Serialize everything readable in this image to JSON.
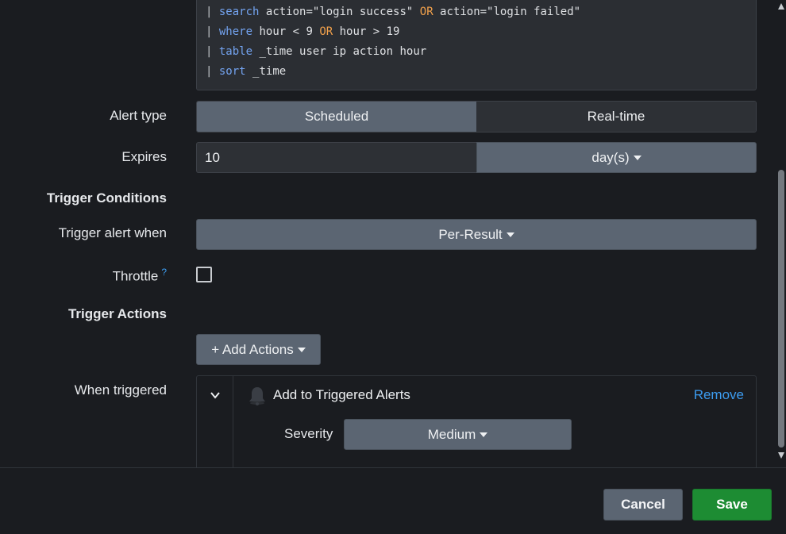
{
  "search": {
    "lines": [
      {
        "pipe": "|",
        "cmd": "search",
        "rest_a": "action=\"login success\" ",
        "op": "OR",
        "rest_b": " action=\"login failed\""
      },
      {
        "pipe": "|",
        "cmd": "where",
        "rest_a": "hour < 9 ",
        "op": "OR",
        "rest_b": " hour > 19"
      },
      {
        "pipe": "|",
        "cmd": "table",
        "rest_a": "_time user ip action hour",
        "op": "",
        "rest_b": ""
      },
      {
        "pipe": "|",
        "cmd": "sort",
        "rest_a": "_time",
        "op": "",
        "rest_b": ""
      }
    ]
  },
  "alert_type": {
    "label": "Alert type",
    "options": [
      "Scheduled",
      "Real-time"
    ],
    "selected": "Scheduled"
  },
  "expires": {
    "label": "Expires",
    "value": "10",
    "unit": "day(s)"
  },
  "trigger_conditions": {
    "heading": "Trigger Conditions",
    "when_label": "Trigger alert when",
    "when_value": "Per-Result",
    "throttle_label": "Throttle",
    "throttle_help": "?",
    "throttle_checked": false
  },
  "trigger_actions": {
    "heading": "Trigger Actions",
    "add_button": "+ Add Actions",
    "when_triggered_label": "When triggered",
    "action": {
      "title": "Add to Triggered Alerts",
      "remove": "Remove",
      "severity_label": "Severity",
      "severity_value": "Medium"
    }
  },
  "footer": {
    "cancel": "Cancel",
    "save": "Save"
  },
  "colors": {
    "background": "#1a1c20",
    "accent_link": "#3c9cf0",
    "save_green": "#1d8c33",
    "button_gray": "#5b6572",
    "keyword_blue": "#73a3f0",
    "operator_orange": "#f2a14b"
  }
}
